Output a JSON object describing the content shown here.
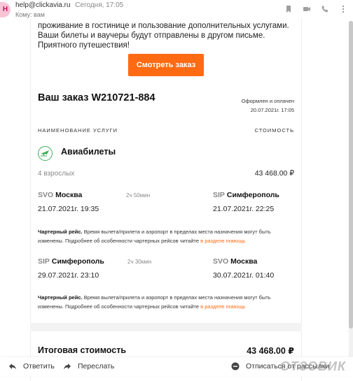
{
  "header": {
    "avatar_letter": "H",
    "sender": "help@clickavia.ru",
    "date": "Сегодня, 17:05",
    "to": "Кому: вам"
  },
  "body": {
    "intro": "проживание в гостинице и пользование дополнительных услугами. Ваши билеты и ваучеры будут отправлены в другом письме. Приятного путешествия!",
    "view_order_button": "Смотреть заказ",
    "order_title": "Ваш заказ W210721-884",
    "order_status": "Оформлен и оплачен",
    "order_datetime": "20.07.2021г. 17:05",
    "col_service": "НАИМЕНОВАНИЕ УСЛУГИ",
    "col_cost": "СТОИМОСТЬ",
    "service_name": "Авиабилеты",
    "passengers": "4 взрослых",
    "service_price": "43 468.00 ₽",
    "segments": [
      {
        "from_code": "SVO",
        "from_city": "Москва",
        "duration": "2ч 50мин",
        "to_code": "SIP",
        "to_city": "Симферополь",
        "dep": "21.07.2021г. 19:35",
        "arr": "21.07.2021г. 22:25"
      },
      {
        "from_code": "SIP",
        "from_city": "Симферополь",
        "duration": "2ч 30мин",
        "to_code": "SVO",
        "to_city": "Москва",
        "dep": "29.07.2021г. 23:10",
        "arr": "30.07.2021г. 01:40"
      }
    ],
    "charter_bold": "Чартерный рейс.",
    "charter_text": " Время вылета/прилета и аэропорт в пределах места назначения могут быть изменены. Подробнее об особенности чартерных рейсов читайте ",
    "charter_link": "в разделе помощь",
    "total_label": "Итоговая стоимость",
    "total_value": "43 468.00 ₽"
  },
  "actions": {
    "reply": "Ответить",
    "forward": "Переслать",
    "report": "Отписаться от рассылки"
  },
  "watermark": "ОТЗОВИК",
  "colors": {
    "accent": "#ff6a13",
    "avatar_bg": "#f8c4d6",
    "icon_green": "#3fae5a"
  }
}
